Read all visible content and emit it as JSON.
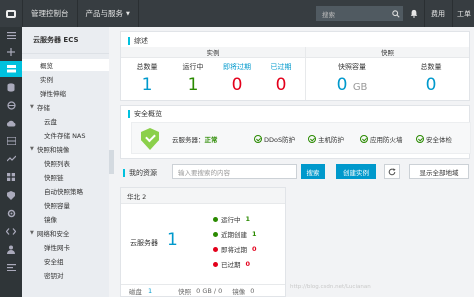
{
  "topbar": {
    "console_label": "管理控制台",
    "products_label": "产品与服务",
    "search_placeholder": "搜索",
    "fee_label": "费用",
    "ticket_label": "工单"
  },
  "sidebar": {
    "title": "云服务器 ECS",
    "items": [
      {
        "label": "概览",
        "active": true,
        "indent": 1
      },
      {
        "label": "实例",
        "indent": 1
      },
      {
        "label": "弹性伸缩",
        "indent": 1
      },
      {
        "label": "存储",
        "group": true
      },
      {
        "label": "云盘",
        "indent": 2
      },
      {
        "label": "文件存储 NAS",
        "indent": 2
      },
      {
        "label": "快照和镜像",
        "group": true
      },
      {
        "label": "快照列表",
        "indent": 2
      },
      {
        "label": "快照链",
        "indent": 2
      },
      {
        "label": "自动快照策略",
        "indent": 2
      },
      {
        "label": "快照容量",
        "indent": 2
      },
      {
        "label": "镜像",
        "indent": 2
      },
      {
        "label": "网络和安全",
        "group": true
      },
      {
        "label": "弹性网卡",
        "indent": 2
      },
      {
        "label": "安全组",
        "indent": 2
      },
      {
        "label": "密钥对",
        "indent": 2
      }
    ]
  },
  "overview": {
    "title": "综述",
    "instances_header": "实例",
    "snapshots_header": "快照",
    "stats": [
      {
        "label": "总数量",
        "value": "1",
        "color": "#0099cc"
      },
      {
        "label": "运行中",
        "value": "1",
        "color": "#2a8a00"
      },
      {
        "label": "即将过期",
        "value": "0",
        "color": "#e3001b",
        "link": true
      },
      {
        "label": "已过期",
        "value": "0",
        "color": "#e3001b",
        "link": true
      }
    ],
    "snapshot_stats": [
      {
        "label": "快照容量",
        "value": "0",
        "unit": "GB",
        "color": "#0099cc"
      },
      {
        "label": "总数量",
        "value": "0",
        "color": "#0099cc"
      }
    ]
  },
  "security": {
    "title": "安全概览",
    "server_label": "云服务器：",
    "server_status": "正常",
    "features": [
      "DDoS防护",
      "主机防护",
      "应用防火墙",
      "安全体检"
    ]
  },
  "resources": {
    "title": "我的资源",
    "search_placeholder": "输入要搜索的内容",
    "search_button": "搜索",
    "create_button": "创建实例",
    "region_button": "显示全部地域",
    "region": {
      "name": "华北 2",
      "server_label": "云服务器",
      "server_count": "1",
      "statuses": [
        {
          "label": "运行中",
          "value": "1",
          "color": "#2a8a00"
        },
        {
          "label": "近期创建",
          "value": "1",
          "color": "#2a8a00"
        },
        {
          "label": "即将过期",
          "value": "0",
          "color": "#e3001b"
        },
        {
          "label": "已过期",
          "value": "0",
          "color": "#e3001b"
        }
      ],
      "footer": {
        "disk_label": "磁盘",
        "disk_value": "1",
        "snap_label": "快照",
        "snap_value": "0 GB / 0",
        "image_label": "镜像",
        "image_value": "0"
      }
    }
  },
  "watermark": "http://blog.csdn.net/Lucianan"
}
